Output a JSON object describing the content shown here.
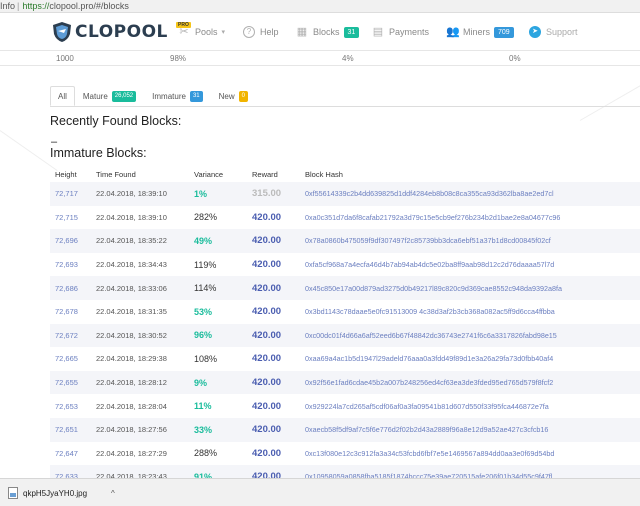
{
  "browser": {
    "url_info": "Info",
    "url_scheme": "https://",
    "url_rest": "clopool.pro/#/blocks"
  },
  "nav": {
    "brand": "CLOPOOL",
    "pro": "PRO",
    "items": [
      {
        "label": "Pools",
        "icon": "tools-icon",
        "badge": ""
      },
      {
        "label": "Help",
        "icon": "question-icon",
        "badge": ""
      },
      {
        "label": "Blocks",
        "icon": "blocks-icon",
        "badge": "31"
      },
      {
        "label": "Payments",
        "icon": "payments-icon",
        "badge": ""
      },
      {
        "label": "Miners",
        "icon": "users-icon",
        "badge": "709"
      },
      {
        "label": "Support",
        "icon": "telegram-icon",
        "badge": ""
      }
    ]
  },
  "stats": [
    "1000",
    "98%",
    "4%",
    "0%"
  ],
  "tabs": [
    {
      "label": "All",
      "badge": ""
    },
    {
      "label": "Mature",
      "badge": "26,052"
    },
    {
      "label": "Immature",
      "badge": "31"
    },
    {
      "label": "New",
      "badge": "0"
    }
  ],
  "recent_title": "Recently Found Blocks:",
  "recent_dash": "–",
  "immature_title": "Immature Blocks:",
  "table": {
    "headers": [
      "Height",
      "Time Found",
      "Variance",
      "Reward",
      "Block Hash"
    ],
    "rows": [
      [
        "72,717",
        "22.04.2018, 18:39:10",
        "1%",
        "315.00",
        "0xf55614339c2b4dd639825d1ddf4284eb8b08c8ca355ca93d362lba8ae2ed7cl"
      ],
      [
        "72,715",
        "22.04.2018, 18:39:10",
        "282%",
        "420.00",
        "0xa0c351d7da6f8cafab21792a3d79c15e5cb9ef276b234b2d1bae2e8a04677c96"
      ],
      [
        "72,696",
        "22.04.2018, 18:35:22",
        "49%",
        "420.00",
        "0x78a0860b475059f9df307497f2c85739bb3dca6ebf51a37b1d8cd00845f02cf"
      ],
      [
        "72,693",
        "22.04.2018, 18:34:43",
        "119%",
        "420.00",
        "0xfa5cf968a7a4ecfa46d4b7ab94ab4dc5e02ba8ff9aab98d12c2d76daaaa57l7d"
      ],
      [
        "72,686",
        "22.04.2018, 18:33:06",
        "114%",
        "420.00",
        "0x45c850e17a00d879ad3275d0b49217l89c820c9d369cae8552c948da9392a8fa"
      ],
      [
        "72,678",
        "22.04.2018, 18:31:35",
        "53%",
        "420.00",
        "0x3bd1143c78daae5e0fc91513009 4c38d3af2b3cb368a082ac5ff9d6cca4ffbba"
      ],
      [
        "72,672",
        "22.04.2018, 18:30:52",
        "96%",
        "420.00",
        "0xc00dc01f4d66a6af52eed6b67f48842dc36743e2741f6c6a3317826fabd98e15"
      ],
      [
        "72,665",
        "22.04.2018, 18:29:38",
        "108%",
        "420.00",
        "0xaa69a4ac1b5d1947l29adeld76aaa0a3fdd49f89d1e3a26a29fa73d0fbb40af4"
      ],
      [
        "72,655",
        "22.04.2018, 18:28:12",
        "9%",
        "420.00",
        "0x92f56e1fad6cdae45b2a007b248256ed4cf63ea3de3fded95ed765d579f8fcf2"
      ],
      [
        "72,653",
        "22.04.2018, 18:28:04",
        "11%",
        "420.00",
        "0x929224la7cd265af5cdf06af0a3fa09541b81d607d550f33f95fca446872e7fa"
      ],
      [
        "72,651",
        "22.04.2018, 18:27:56",
        "33%",
        "420.00",
        "0xaecb58f5df9af7c5f6e776d2f02b2d43a2889f96a8e12d9a52ae427c3cfcb16"
      ],
      [
        "72,647",
        "22.04.2018, 18:27:29",
        "288%",
        "420.00",
        "0xc13f080e12c3c912fa3a34c53fcbd6fbf7e5e1469567a894dd0aa3e0f69d54bd"
      ],
      [
        "72,633",
        "22.04.2018, 18:23:43",
        "91%",
        "420.00",
        "0x10958059a0858fba5185f1874bccc75e39ae720515afe206f01b34d55c9f47fl"
      ]
    ]
  },
  "download": {
    "filename": "qkpH5JyaYH0.jpg"
  }
}
